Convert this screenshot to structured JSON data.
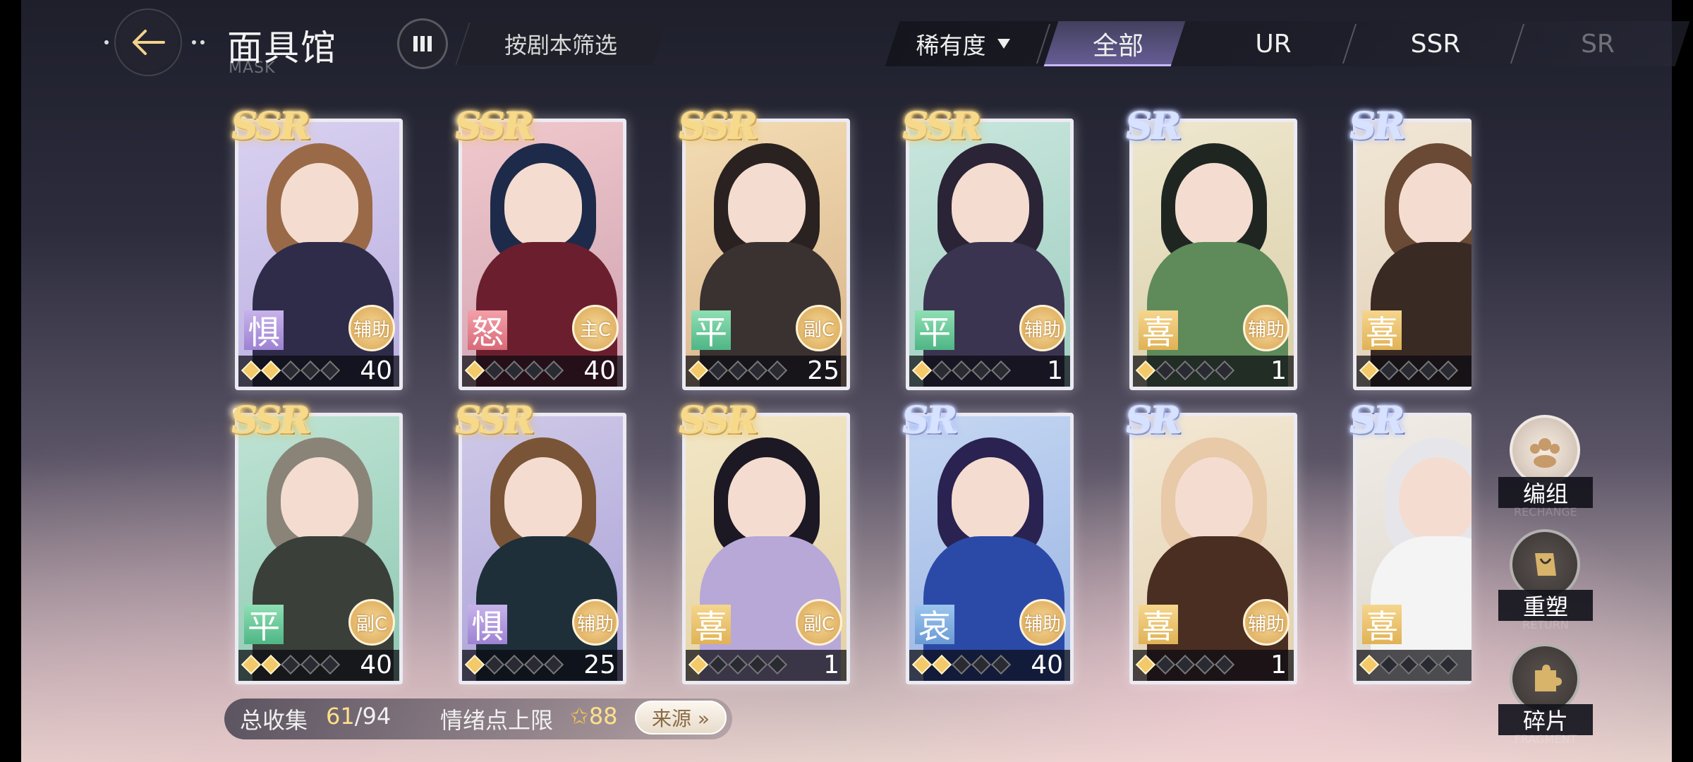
{
  "header": {
    "title": "面具馆",
    "subtitle": "MASK",
    "filter_label": "按剧本筛选"
  },
  "rarity_bar": {
    "sort_label": "稀有度",
    "tabs": [
      "全部",
      "UR",
      "SSR",
      "SR"
    ],
    "selected": "全部"
  },
  "cards": [
    {
      "rarity": "SSR",
      "emotion": "惧",
      "role": "辅助",
      "level": "40",
      "stars": 2,
      "palette": "lavender"
    },
    {
      "rarity": "SSR",
      "emotion": "怒",
      "role": "主C",
      "level": "40",
      "stars": 1,
      "palette": "navy"
    },
    {
      "rarity": "SSR",
      "emotion": "平",
      "role": "副C",
      "level": "25",
      "stars": 1,
      "palette": "dark"
    },
    {
      "rarity": "SSR",
      "emotion": "平",
      "role": "辅助",
      "level": "1",
      "stars": 1,
      "palette": "gothic"
    },
    {
      "rarity": "SR",
      "emotion": "喜",
      "role": "辅助",
      "level": "1",
      "stars": 1,
      "palette": "green"
    },
    {
      "rarity": "SR",
      "emotion": "喜",
      "role": "",
      "level": "",
      "stars": 1,
      "palette": "brown"
    },
    {
      "rarity": "SSR",
      "emotion": "平",
      "role": "副C",
      "level": "40",
      "stars": 2,
      "palette": "olive"
    },
    {
      "rarity": "SSR",
      "emotion": "惧",
      "role": "辅助",
      "level": "25",
      "stars": 1,
      "palette": "teal"
    },
    {
      "rarity": "SSR",
      "emotion": "喜",
      "role": "副C",
      "level": "1",
      "stars": 1,
      "palette": "purple"
    },
    {
      "rarity": "SR",
      "emotion": "哀",
      "role": "辅助",
      "level": "40",
      "stars": 2,
      "palette": "blue"
    },
    {
      "rarity": "SR",
      "emotion": "喜",
      "role": "辅助",
      "level": "1",
      "stars": 1,
      "palette": "cream"
    },
    {
      "rarity": "SR",
      "emotion": "喜",
      "role": "",
      "level": "",
      "stars": 1,
      "palette": "white"
    }
  ],
  "bottom_bar": {
    "collect_label": "总收集",
    "collect_count": "61",
    "collect_total": "/94",
    "mood_label": "情绪点上限",
    "mood_value": "88",
    "source_label": "来源 »"
  },
  "side_buttons": [
    {
      "label": "编组",
      "sub": "RECHANGE",
      "icon": "group-icon"
    },
    {
      "label": "重塑",
      "sub": "RETURN",
      "icon": "reshape-icon"
    },
    {
      "label": "碎片",
      "sub": "FRAGMENT",
      "icon": "puzzle-icon"
    }
  ],
  "colors": {
    "ssr_gold": "#f7d98a",
    "sr_silver": "#d6e2ff",
    "accent_tab": "#c8b8ff",
    "count_highlight": "#ffe08a"
  }
}
